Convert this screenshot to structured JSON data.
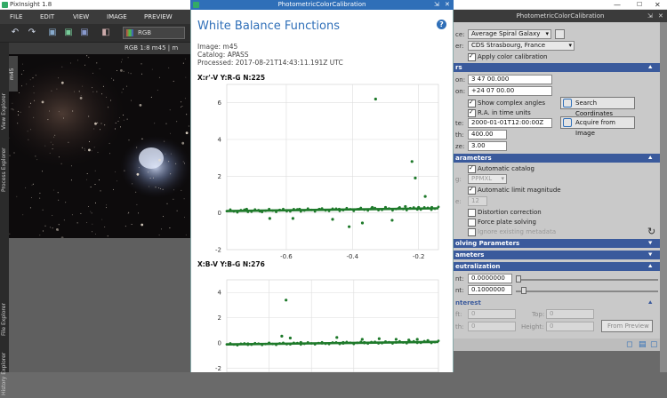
{
  "app": {
    "title": "PixInsight 1.8"
  },
  "menu": [
    "FILE",
    "EDIT",
    "VIEW",
    "IMAGE",
    "PREVIEW"
  ],
  "toolbar": {
    "channel_select": "RGB"
  },
  "image_window": {
    "title": "RGB 1:8 m45 | m",
    "tab": "m45"
  },
  "left_tabs": [
    "View Explorer",
    "Process Explorer",
    "File Explorer",
    "History Explorer"
  ],
  "dialog": {
    "title": "PhotometricColorCalibration",
    "heading": "White Balance Functions",
    "image": "Image: m45",
    "catalog": "Catalog: APASS",
    "processed": "Processed: 2017-08-21T14:43:11.191Z UTC",
    "help": "?"
  },
  "chart_data": [
    {
      "type": "scatter",
      "title": "X:r'-V   Y:R-G   N:225",
      "xlabel": "",
      "ylabel": "",
      "xlim": [
        -0.78,
        -0.14
      ],
      "ylim": [
        -2,
        7
      ],
      "xticks": [
        -0.6,
        -0.4,
        -0.2
      ],
      "yticks": [
        6,
        4,
        2,
        0,
        -2
      ],
      "grid": true,
      "trend": [
        [
          -0.78,
          0.1
        ],
        [
          -0.14,
          0.25
        ]
      ],
      "points": [
        [
          -0.33,
          6.2
        ],
        [
          -0.22,
          2.8
        ],
        [
          -0.21,
          1.9
        ],
        [
          -0.22,
          -4.0
        ],
        [
          -0.2,
          -5.0
        ],
        [
          -0.41,
          -0.75
        ],
        [
          -0.37,
          -0.55
        ],
        [
          -0.46,
          -0.35
        ],
        [
          -0.58,
          -0.3
        ],
        [
          -0.65,
          -0.3
        ],
        [
          -0.28,
          -0.4
        ],
        [
          -0.18,
          0.9
        ],
        [
          -0.72,
          0.2
        ],
        [
          -0.68,
          0.1
        ],
        [
          -0.62,
          0.15
        ],
        [
          -0.56,
          0.2
        ],
        [
          -0.5,
          0.2
        ],
        [
          -0.44,
          0.2
        ],
        [
          -0.38,
          0.2
        ],
        [
          -0.34,
          0.3
        ],
        [
          -0.3,
          0.3
        ],
        [
          -0.26,
          0.25
        ],
        [
          -0.24,
          0.35
        ],
        [
          -0.2,
          0.3
        ],
        [
          -0.16,
          0.3
        ]
      ]
    },
    {
      "type": "scatter",
      "title": "X:B-V   Y:B-G   N:276",
      "xlabel": "",
      "ylabel": "",
      "xlim": [
        0,
        1
      ],
      "ylim": [
        -2.3,
        5
      ],
      "yticks": [
        4,
        2,
        0,
        -2
      ],
      "grid": true,
      "trend": [
        [
          0.0,
          -0.1
        ],
        [
          1.0,
          0.1
        ]
      ],
      "points": [
        [
          0.28,
          3.4
        ],
        [
          0.26,
          0.55
        ],
        [
          0.3,
          0.4
        ],
        [
          0.52,
          0.45
        ],
        [
          0.64,
          0.3
        ],
        [
          0.72,
          0.35
        ],
        [
          0.8,
          0.3
        ],
        [
          0.86,
          0.25
        ],
        [
          0.9,
          0.3
        ],
        [
          0.95,
          0.2
        ],
        [
          0.1,
          -0.05
        ],
        [
          0.2,
          0.0
        ],
        [
          0.35,
          0.05
        ],
        [
          0.45,
          0.0
        ],
        [
          0.55,
          0.05
        ],
        [
          0.65,
          0.05
        ],
        [
          0.75,
          0.1
        ]
      ]
    }
  ],
  "process": {
    "title": "PhotometricColorCalibration",
    "white_ref_label": "ce:",
    "white_ref": "Average Spiral Galaxy",
    "server_label": "er:",
    "server": "CDS Strasbourg, France",
    "apply_color": "Apply color calibration",
    "sec_image": "rs",
    "ra_label": "on:",
    "ra": "3 47 00.000",
    "dec_label": "on:",
    "dec": "+24 07 00.00",
    "show_complex": "Show complex angles",
    "ra_time": "R.A. in time units",
    "search_btn": "Search Coordinates",
    "date_label": "te:",
    "date": "2000-01-01T12:00:00Z",
    "acquire_btn": "Acquire from Image",
    "focal_label": "th:",
    "focal": "400.00",
    "pixel_label": "ze:",
    "pixel": "3.00",
    "sec_params": "arameters",
    "auto_catalog": "Automatic catalog",
    "catalog_label": "g:",
    "catalog_val": "PPMXL",
    "auto_limit": "Automatic limit magnitude",
    "limit_label": "e:",
    "limit_val": "12",
    "distortion": "Distortion correction",
    "force_plate": "Force plate solving",
    "ignore_meta": "Ignore existing metadata",
    "sec_solving": "olving Parameters",
    "sec_ameters": "ameters",
    "sec_neutral": "eutralization",
    "low_label": "nt:",
    "low_val": "0.0000000",
    "high_label": "nt:",
    "high_val": "0.1000000",
    "sec_roi": "nterest",
    "roi_left_label": "ft:",
    "roi_left": "0",
    "roi_top_label": "Top:",
    "roi_top": "0",
    "roi_width_label": "th:",
    "roi_width": "0",
    "roi_height_label": "Height:",
    "roi_height": "0",
    "from_preview": "From Preview"
  }
}
